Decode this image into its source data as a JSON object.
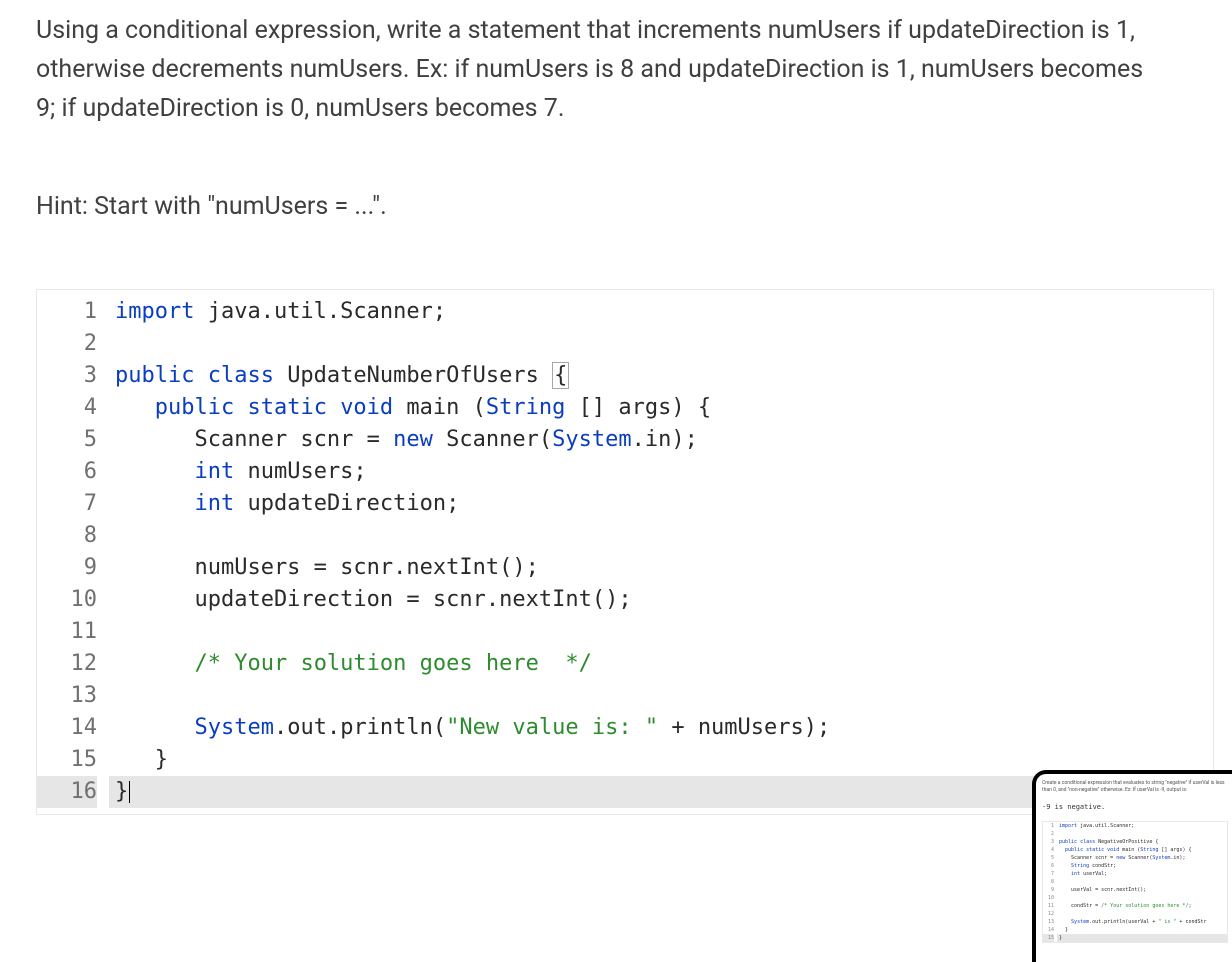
{
  "problem": {
    "description": "Using a conditional expression, write a statement that increments numUsers if updateDirection is 1, otherwise decrements numUsers. Ex: if numUsers is 8 and updateDirection is 1, numUsers becomes 9; if updateDirection is 0, numUsers becomes 7.",
    "hint": "Hint: Start with \"numUsers = ...\"."
  },
  "code": {
    "line_numbers": [
      "1",
      "2",
      "3",
      "4",
      "5",
      "6",
      "7",
      "8",
      "9",
      "10",
      "11",
      "12",
      "13",
      "14",
      "15",
      "16"
    ],
    "current_line_index": 15,
    "lines": {
      "1": {
        "tokens": [
          [
            "import ",
            "kw"
          ],
          [
            "java.util.Scanner;",
            "id"
          ]
        ]
      },
      "2": {
        "tokens": []
      },
      "3": {
        "tokens": [
          [
            "public class ",
            "kw"
          ],
          [
            "UpdateNumberOfUsers ",
            "id"
          ],
          [
            "{",
            "brace-box"
          ]
        ]
      },
      "4": {
        "tokens": [
          [
            "   ",
            ""
          ],
          [
            "public static ",
            "kw"
          ],
          [
            "void ",
            "type"
          ],
          [
            "main (",
            "id"
          ],
          [
            "String",
            "type"
          ],
          [
            " [] args) {",
            "id"
          ]
        ]
      },
      "5": {
        "tokens": [
          [
            "      Scanner scnr = ",
            "id"
          ],
          [
            "new ",
            "kw"
          ],
          [
            "Scanner(",
            "id"
          ],
          [
            "System",
            "type"
          ],
          [
            ".in);",
            "id"
          ]
        ]
      },
      "6": {
        "tokens": [
          [
            "      ",
            ""
          ],
          [
            "int ",
            "type"
          ],
          [
            "numUsers;",
            "id"
          ]
        ]
      },
      "7": {
        "tokens": [
          [
            "      ",
            ""
          ],
          [
            "int ",
            "type"
          ],
          [
            "updateDirection;",
            "id"
          ]
        ]
      },
      "8": {
        "tokens": []
      },
      "9": {
        "tokens": [
          [
            "      numUsers = scnr.nextInt();",
            "id"
          ]
        ]
      },
      "10": {
        "tokens": [
          [
            "      updateDirection = scnr.nextInt();",
            "id"
          ]
        ]
      },
      "11": {
        "tokens": []
      },
      "12": {
        "tokens": [
          [
            "      ",
            ""
          ],
          [
            "/* Your solution goes here  */",
            "cmt"
          ]
        ]
      },
      "13": {
        "tokens": []
      },
      "14": {
        "tokens": [
          [
            "      ",
            ""
          ],
          [
            "System",
            "type"
          ],
          [
            ".out.println(",
            "id"
          ],
          [
            "\"New value is: \"",
            "str"
          ],
          [
            " + numUsers);",
            "id"
          ]
        ]
      },
      "15": {
        "tokens": [
          [
            "   }",
            "id"
          ]
        ]
      },
      "16": {
        "tokens": [
          [
            "}",
            "id"
          ]
        ],
        "caret": true
      }
    }
  },
  "popup": {
    "description": "Create a conditional expression that evaluates to string \"negative\" if userVal is less than 0, and \"non-negative\" otherwise. Ex: If userVal is -9, output is:",
    "example": "-9 is negative.",
    "line_numbers": [
      "1",
      "2",
      "3",
      "4",
      "5",
      "6",
      "7",
      "8",
      "9",
      "10",
      "11",
      "12",
      "13",
      "14",
      "15"
    ],
    "current_line_index": 14,
    "lines": {
      "1": {
        "tokens": [
          [
            "import ",
            "pkw"
          ],
          [
            "java.util.Scanner;",
            ""
          ]
        ]
      },
      "2": {
        "tokens": []
      },
      "3": {
        "tokens": [
          [
            "public class ",
            "pkw"
          ],
          [
            "NegativeOrPositive {",
            ""
          ]
        ]
      },
      "4": {
        "tokens": [
          [
            "  ",
            ""
          ],
          [
            "public static void ",
            "pkw"
          ],
          [
            "main (",
            ""
          ],
          [
            "String",
            "pkw"
          ],
          [
            " [] args) {",
            ""
          ]
        ]
      },
      "5": {
        "tokens": [
          [
            "    Scanner scnr = ",
            ""
          ],
          [
            "new ",
            "pkw"
          ],
          [
            "Scanner(",
            ""
          ],
          [
            "System",
            "pkw"
          ],
          [
            ".in);",
            ""
          ]
        ]
      },
      "6": {
        "tokens": [
          [
            "    ",
            ""
          ],
          [
            "String",
            "pkw"
          ],
          [
            " condStr;",
            ""
          ]
        ]
      },
      "7": {
        "tokens": [
          [
            "    ",
            ""
          ],
          [
            "int ",
            "pkw"
          ],
          [
            "userVal;",
            ""
          ]
        ]
      },
      "8": {
        "tokens": []
      },
      "9": {
        "tokens": [
          [
            "    userVal = scnr.nextInt();",
            ""
          ]
        ]
      },
      "10": {
        "tokens": []
      },
      "11": {
        "tokens": [
          [
            "    condStr = ",
            ""
          ],
          [
            "/* Your solution goes here */",
            "pstr"
          ],
          [
            ";",
            ""
          ]
        ]
      },
      "12": {
        "tokens": []
      },
      "13": {
        "tokens": [
          [
            "    ",
            ""
          ],
          [
            "System",
            "pkw"
          ],
          [
            ".out.println(userVal + ",
            ""
          ],
          [
            "\" is \"",
            "pstr"
          ],
          [
            " + condStr",
            ""
          ]
        ]
      },
      "14": {
        "tokens": [
          [
            "  }",
            ""
          ]
        ]
      },
      "15": {
        "tokens": [
          [
            "}",
            ""
          ]
        ]
      }
    }
  }
}
